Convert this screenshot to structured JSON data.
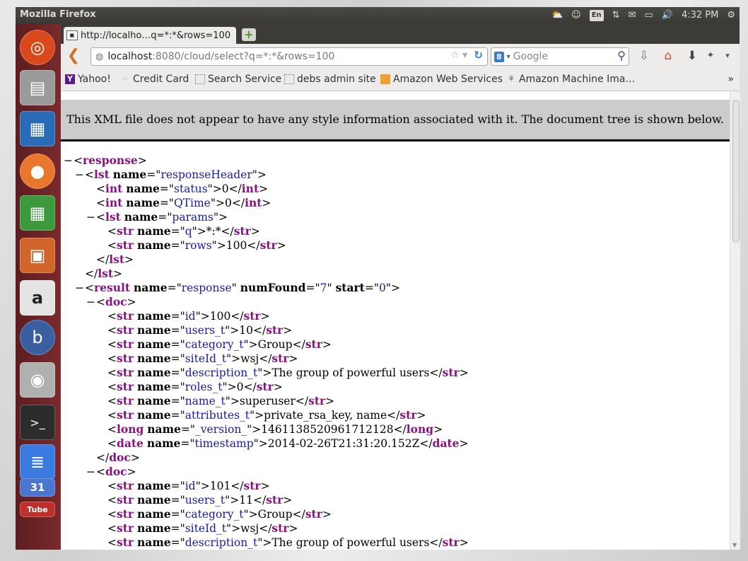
{
  "panel": {
    "app_title": "Mozilla Firefox",
    "keyboard_layout": "En",
    "clock": "4:32 PM"
  },
  "launcher": {
    "items": [
      {
        "name": "ubuntu-dash-icon",
        "color": "#d84a1b"
      },
      {
        "name": "files-icon",
        "color": "#8a8a8a"
      },
      {
        "name": "writer-icon",
        "color": "#2a6bb8"
      },
      {
        "name": "firefox-icon",
        "color": "#e8762c"
      },
      {
        "name": "calc-icon",
        "color": "#3c9a3c"
      },
      {
        "name": "impress-icon",
        "color": "#d0662a"
      },
      {
        "name": "amazon-icon",
        "color": "#e4e4e4"
      },
      {
        "name": "bugzilla-icon",
        "color": "#3a5fa0"
      },
      {
        "name": "speaker-icon",
        "color": "#b0b0b0"
      },
      {
        "name": "terminal-icon",
        "color": "#2c2c2c"
      },
      {
        "name": "docs-icon",
        "color": "#3b7be0"
      },
      {
        "name": "calendar-icon",
        "color": "#4a76d0"
      },
      {
        "name": "youtube-icon",
        "color": "#c0302a"
      }
    ],
    "calendar_day": "31",
    "youtube_label": "Tube",
    "amazon_glyph": "a"
  },
  "tab": {
    "title": "http://localho…q=*:*&rows=100",
    "new_tab_glyph": "+"
  },
  "navbar": {
    "url_host": "localhost",
    "url_path": ":8080/cloud/select?q=*:*&rows=100",
    "search_placeholder": "Google",
    "search_engine_glyph": "8"
  },
  "bookmarks": [
    {
      "label": "Yahoo!",
      "icon": "yahoo-icon"
    },
    {
      "label": "Credit Card",
      "icon": "spinner-icon"
    },
    {
      "label": "Search Service",
      "icon": "page-icon"
    },
    {
      "label": "debs admin site",
      "icon": "page-icon"
    },
    {
      "label": "Amazon Web Services",
      "icon": "aws-box-icon"
    },
    {
      "label": "Amazon Machine Ima…",
      "icon": "machine-icon"
    }
  ],
  "notice": "This XML file does not appear to have any style information associated with it. The document tree is shown below.",
  "xml": {
    "response": "response",
    "lst": "lst",
    "int": "int",
    "str": "str",
    "result": "result",
    "doc": "doc",
    "long": "long",
    "date": "date",
    "name_attr": "name",
    "numFound_attr": "numFound",
    "start_attr": "start",
    "responseHeader": "responseHeader",
    "status": "status",
    "status_val": "0",
    "qtime": "QTime",
    "qtime_val": "0",
    "params": "params",
    "q": "q",
    "q_val": "*:*",
    "rows": "rows",
    "rows_val": "100",
    "result_name": "response",
    "numFound": "7",
    "start": "0",
    "doc1": {
      "id": "100",
      "users_t": "10",
      "category_t": "Group",
      "siteId_t": "wsj",
      "description_t": "The group of powerful users",
      "roles_t": "0",
      "name_t": "superuser",
      "attributes_t": "private_rsa_key, name",
      "_version_": "1461138520961712128",
      "timestamp": "2014-02-26T21:31:20.152Z"
    },
    "doc2": {
      "id": "101",
      "users_t": "11",
      "category_t": "Group",
      "siteId_t": "wsj",
      "description_t": "The group of powerful users"
    },
    "keys": {
      "id": "id",
      "users_t": "users_t",
      "category_t": "category_t",
      "siteId_t": "siteId_t",
      "description_t": "description_t",
      "roles_t": "roles_t",
      "name_t": "name_t",
      "attributes_t": "attributes_t",
      "_version_": "_version_",
      "timestamp": "timestamp"
    }
  }
}
